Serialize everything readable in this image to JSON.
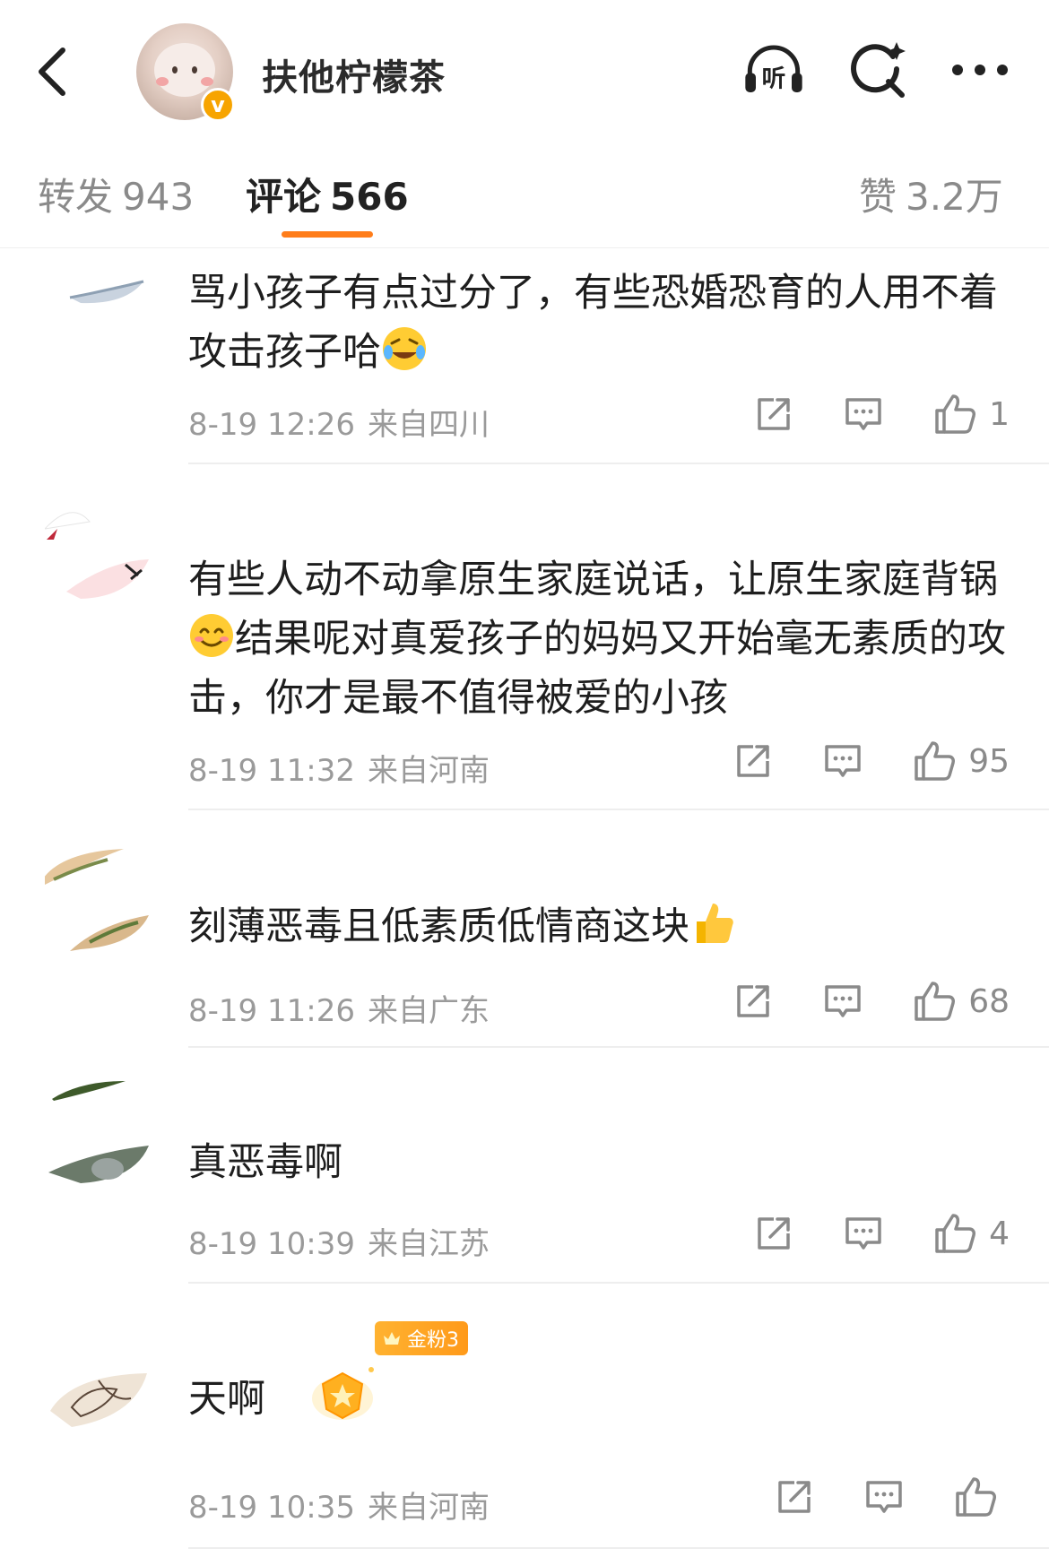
{
  "header": {
    "back_icon": "chevron-left-icon",
    "username": "扶他柠檬茶",
    "verified_badge": "v",
    "listen_label": "听",
    "search_icon": "search-sparkle-icon",
    "more_icon": "more-dots-icon"
  },
  "tabs": [
    {
      "label": "转发",
      "count": "943",
      "active": false
    },
    {
      "label": "评论",
      "count": "566",
      "active": true
    },
    {
      "label": "赞",
      "count": "3.2万",
      "active": false
    }
  ],
  "comments": [
    {
      "text": "骂小孩子有点过分了，有些恐婚恐育的人用不着攻击孩子哈",
      "emoji": "laughing-crying-emoji",
      "time": "8-19 12:26",
      "location": "来自四川",
      "likes": "1"
    },
    {
      "text_before": "有些人动不动拿原生家庭说话，让原生家庭背锅",
      "emoji": "smiling-emoji",
      "text_after": "结果呢对真爱孩子的妈妈又开始毫无素质的攻击，你才是最不值得被爱的小孩",
      "time": "8-19 11:32",
      "location": "来自河南",
      "likes": "95"
    },
    {
      "text": "刻薄恶毒且低素质低情商这块",
      "emoji": "thumbs-up-emoji",
      "time": "8-19 11:26",
      "location": "来自广东",
      "likes": "68"
    },
    {
      "text": "真恶毒啊",
      "time": "8-19 10:39",
      "location": "来自江苏",
      "likes": "4"
    },
    {
      "text": "天啊",
      "badge": "金粉3",
      "sticker": "gold-fan-sticker",
      "time": "8-19 10:35",
      "location": "来自河南",
      "likes": ""
    }
  ],
  "colors": {
    "accent": "#ff7d1a",
    "badge_gold": "#f7a400",
    "muted": "#9a9a9a"
  }
}
